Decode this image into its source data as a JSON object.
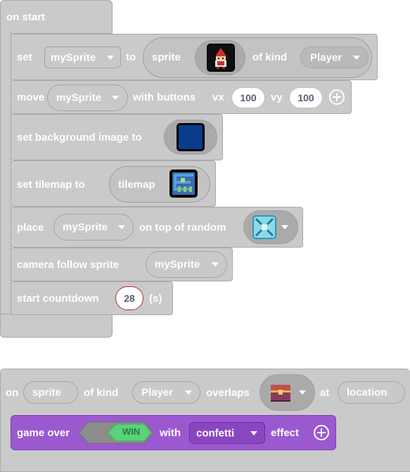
{
  "colors": {
    "block": "#cacaca",
    "block_border": "#a9a9a9",
    "game_block": "#9b59d0",
    "win_badge": "#5ad27a",
    "text": "#ffffff"
  },
  "on_start": {
    "hat_label": "on start",
    "set_sprite": {
      "set": "set",
      "variable": "mySprite",
      "to": "to",
      "sprite": "sprite",
      "sprite_image": "red-wizard-sprite-icon",
      "of_kind": "of kind",
      "kind": "Player"
    },
    "move": {
      "move": "move",
      "variable": "mySprite",
      "with_buttons": "with buttons",
      "vx_label": "vx",
      "vx": "100",
      "vy_label": "vy",
      "vy": "100"
    },
    "background": {
      "label": "set background image to",
      "image": "dark-blue-background-icon"
    },
    "tilemap": {
      "label": "set tilemap to",
      "tilemap": "tilemap",
      "image": "maze-tilemap-icon"
    },
    "place": {
      "place": "place",
      "variable": "mySprite",
      "on_top_of_random": "on top of random",
      "tile": "cyan-tile-icon"
    },
    "camera": {
      "label": "camera follow sprite",
      "variable": "mySprite"
    },
    "countdown": {
      "label": "start countdown",
      "value": "28",
      "unit": "(s)"
    }
  },
  "overlap": {
    "on": "on",
    "sprite": "sprite",
    "of_kind": "of kind",
    "kind": "Player",
    "overlaps": "overlaps",
    "tile": "treasure-chest-tile-icon",
    "at": "at",
    "location": "location",
    "game_over": {
      "label": "game over",
      "result": "WIN",
      "with": "with",
      "effect_value": "confetti",
      "effect": "effect"
    }
  }
}
